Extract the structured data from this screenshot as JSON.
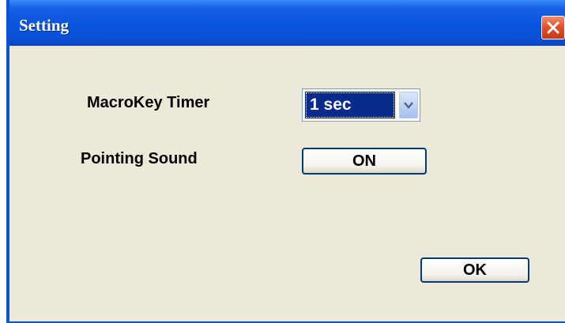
{
  "window": {
    "title": "Setting",
    "close_icon": "close-icon"
  },
  "settings": {
    "macrokey_timer": {
      "label": "MacroKey Timer",
      "value": "1 sec",
      "arrow_icon": "chevron-down-icon"
    },
    "pointing_sound": {
      "label": "Pointing Sound",
      "value": "ON"
    }
  },
  "actions": {
    "ok_label": "OK"
  },
  "colors": {
    "titlebar": "#0a55df",
    "body": "#ece9d8",
    "close": "#e2532d",
    "selection": "#0a2a8c"
  }
}
